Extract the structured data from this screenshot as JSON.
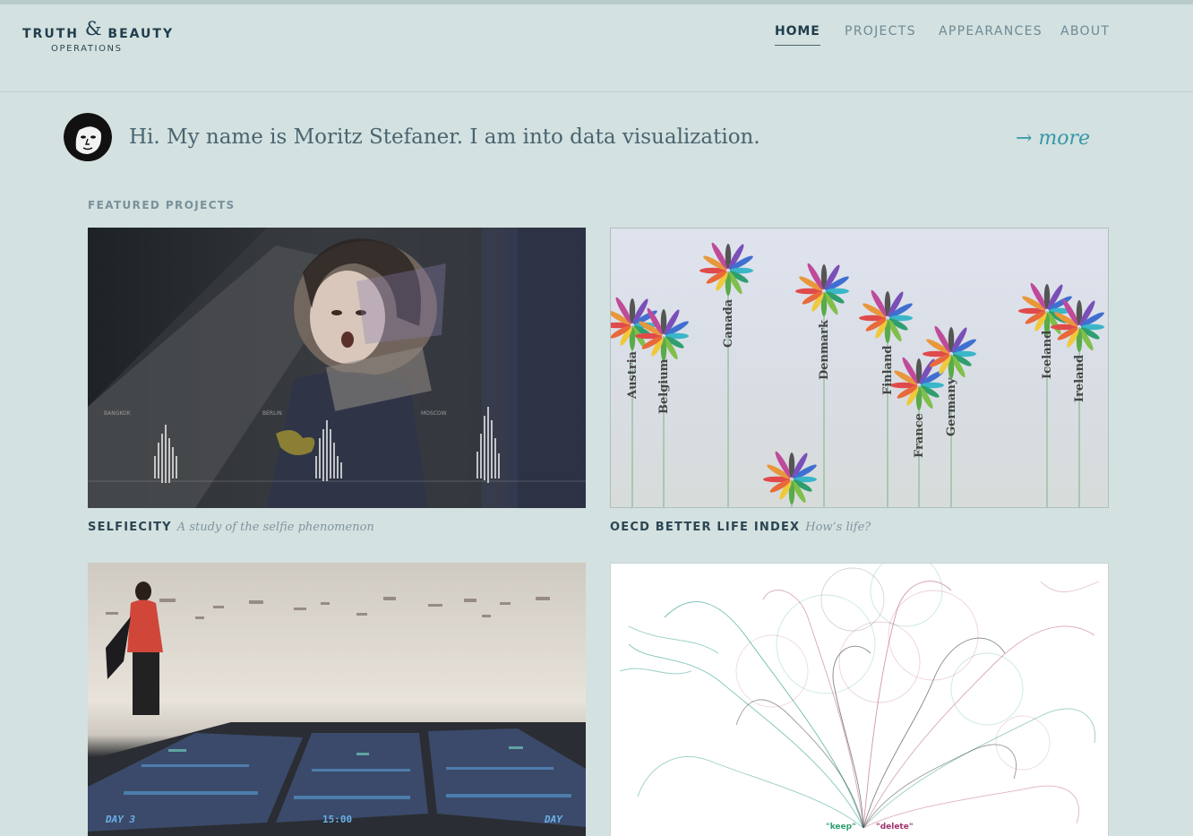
{
  "logo": {
    "word1": "TRUTH",
    "amp": "&",
    "word2": "BEAUTY",
    "sub": "OPERATIONS"
  },
  "nav": {
    "items": [
      "HOME",
      "PROJECTS",
      "APPEARANCES",
      "ABOUT"
    ],
    "active": "HOME"
  },
  "intro": {
    "text": "Hi. My name is Moritz Stefaner. I am into data visualization.",
    "more": "→ more"
  },
  "section_label": "FEATURED PROJECTS",
  "projects": [
    {
      "title": "SELFIECITY",
      "subtitle": "A study of the selfie phenomenon",
      "image_labels": [
        "BANGKOK",
        "BERLIN",
        "MOSCOW"
      ]
    },
    {
      "title": "OECD BETTER LIFE INDEX",
      "subtitle": "How’s life?",
      "image_labels": [
        "Austria",
        "Belgium",
        "Canada",
        "Denmark",
        "Finland",
        "France",
        "Germany",
        "Iceland",
        "Ireland"
      ]
    },
    {
      "title": "",
      "subtitle": "",
      "image_labels": [
        "DAY 3",
        "15:00",
        "DAY"
      ]
    },
    {
      "title": "",
      "subtitle": "",
      "image_labels": [
        "\"keep\"",
        "\"delete\""
      ]
    }
  ],
  "colors": {
    "background": "#d3e1e0",
    "text_dark": "#1f3d4c",
    "nav_inactive": "#6e8a95",
    "link_accent": "#3797a8",
    "petals": [
      "#e04a4a",
      "#e8973a",
      "#f0c83c",
      "#7fbf4a",
      "#2f9e6e",
      "#3ab6c8",
      "#3f6fd0",
      "#7a4fb8",
      "#c04a9a",
      "#555555"
    ]
  },
  "icons": {
    "more_arrow": "arrow-right-icon"
  }
}
